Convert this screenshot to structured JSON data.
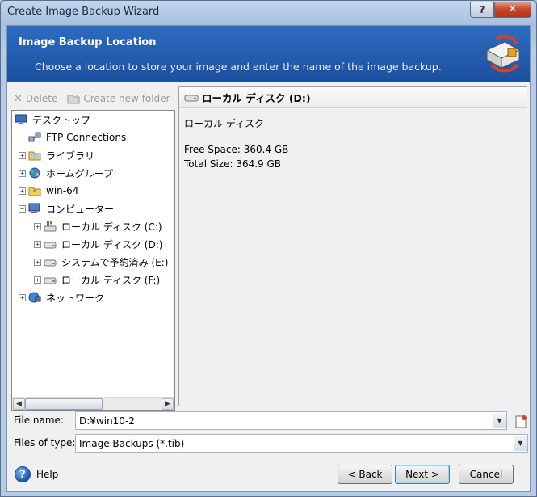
{
  "window": {
    "title": "Create Image Backup Wizard",
    "help_glyph": "?",
    "close_glyph": "✕"
  },
  "banner": {
    "title": "Image Backup Location",
    "subtitle": "Choose a location to store your image and enter the name of the image backup."
  },
  "toolbar": {
    "delete_label": "Delete",
    "new_folder_label": "Create new folder"
  },
  "tree": {
    "items": [
      {
        "label": "デスクトップ",
        "icon": "desktop-icon",
        "depth": 0,
        "expander": ""
      },
      {
        "label": "FTP Connections",
        "icon": "ftp-icon",
        "depth": 1,
        "expander": ""
      },
      {
        "label": "ライブラリ",
        "icon": "library-icon",
        "depth": 1,
        "expander": "+"
      },
      {
        "label": "ホームグループ",
        "icon": "homegroup-icon",
        "depth": 1,
        "expander": "+"
      },
      {
        "label": "win-64",
        "icon": "user-folder-icon",
        "depth": 1,
        "expander": "+"
      },
      {
        "label": "コンピューター",
        "icon": "computer-icon",
        "depth": 1,
        "expander": "−"
      },
      {
        "label": "ローカル ディスク (C:)",
        "icon": "system-drive-icon",
        "depth": 2,
        "expander": "+"
      },
      {
        "label": "ローカル ディスク (D:)",
        "icon": "drive-icon",
        "depth": 2,
        "expander": "+"
      },
      {
        "label": "システムで予約済み (E:)",
        "icon": "drive-icon",
        "depth": 2,
        "expander": "+"
      },
      {
        "label": "ローカル ディスク (F:)",
        "icon": "drive-icon",
        "depth": 2,
        "expander": "+"
      },
      {
        "label": "ネットワーク",
        "icon": "network-icon",
        "depth": 1,
        "expander": "+"
      }
    ]
  },
  "details": {
    "heading": "ローカル ディスク (D:)",
    "name": "ローカル ディスク",
    "free_space": "Free Space: 360.4 GB",
    "total_size": "Total Size: 364.9 GB"
  },
  "form": {
    "file_name_label": "File name:",
    "file_name_value": "D:¥win10-2",
    "files_of_type_label": "Files of type:",
    "files_of_type_value": "Image Backups (*.tib)"
  },
  "footer": {
    "help_label": "Help",
    "back_label": "< Back",
    "next_label": "Next >",
    "cancel_label": "Cancel"
  },
  "colors": {
    "banner": "#2d6cc0",
    "close": "#c7452b",
    "tree_bg": "#ffffff"
  }
}
